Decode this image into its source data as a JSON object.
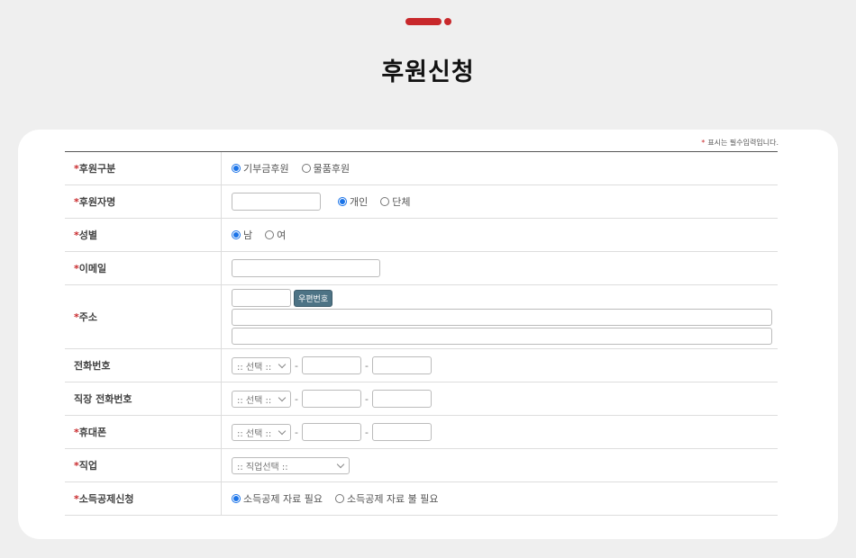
{
  "page": {
    "title": "후원신청",
    "accent_color": "#c8282b"
  },
  "form": {
    "required_note": "표시는 필수입력입니다.",
    "required_mark": "*",
    "rows": {
      "support_type": {
        "label": "후원구분",
        "options": [
          "기부금후원",
          "물품후원"
        ],
        "selected": "기부금후원"
      },
      "sponsor_name": {
        "label": "후원자명",
        "value": "",
        "options": [
          "개인",
          "단체"
        ],
        "selected": "개인"
      },
      "gender": {
        "label": "성별",
        "options": [
          "남",
          "여"
        ],
        "selected": "남"
      },
      "email": {
        "label": "이메일",
        "value": ""
      },
      "address": {
        "label": "주소",
        "zip_button": "우편번호"
      },
      "phone": {
        "label": "전화번호",
        "select_placeholder": ":: 선택 ::",
        "dash": "-"
      },
      "work_phone": {
        "label": "직장 전화번호",
        "select_placeholder": ":: 선택 ::",
        "dash": "-"
      },
      "mobile": {
        "label": "휴대폰",
        "select_placeholder": ":: 선택 ::",
        "dash": "-"
      },
      "job": {
        "label": "직업",
        "select_placeholder": ":: 직업선택 ::"
      },
      "tax_deduction": {
        "label": "소득공제신청",
        "options": [
          "소득공제 자료 필요",
          "소득공제 자료 불 필요"
        ],
        "selected": "소득공제 자료 필요"
      }
    }
  }
}
